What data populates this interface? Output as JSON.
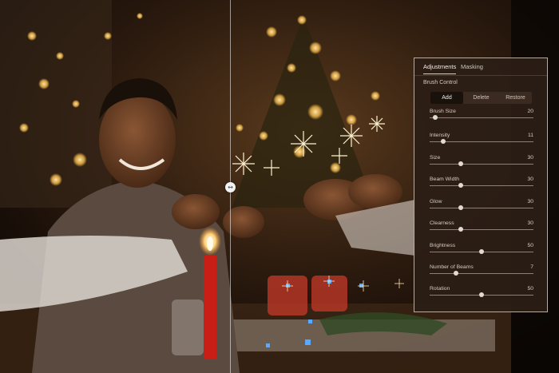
{
  "panel": {
    "tabs": [
      {
        "label": "Adjustments",
        "active": true
      },
      {
        "label": "Masking",
        "active": false
      }
    ],
    "section_title": "Brush Control",
    "modes": [
      {
        "label": "Add",
        "active": true
      },
      {
        "label": "Delete",
        "active": false
      },
      {
        "label": "Restore",
        "active": false
      }
    ],
    "sliders": [
      {
        "label": "Brush Size",
        "value": "20",
        "level": 0.05
      },
      {
        "label": "Intensity",
        "value": "11",
        "level": 0.13
      },
      {
        "label": "Size",
        "value": "30",
        "level": 0.3
      },
      {
        "label": "Beam Width",
        "value": "30",
        "level": 0.3
      },
      {
        "label": "Glow",
        "value": "30",
        "level": 0.3
      },
      {
        "label": "Clearness",
        "value": "30",
        "level": 0.3
      },
      {
        "label": "Brightness",
        "value": "50",
        "level": 0.5
      },
      {
        "label": "Number of Beams",
        "value": "7",
        "level": 0.25
      },
      {
        "label": "Rotation",
        "value": "50",
        "level": 0.5
      }
    ]
  },
  "colors": {
    "panel_bg": "#2b1e16",
    "panel_border": "#b8aa9c",
    "candle_red": "#c81e16",
    "bokeh_gold": "#f4b94a"
  },
  "icons": {
    "divider_handle": "double-arrow-icon"
  }
}
